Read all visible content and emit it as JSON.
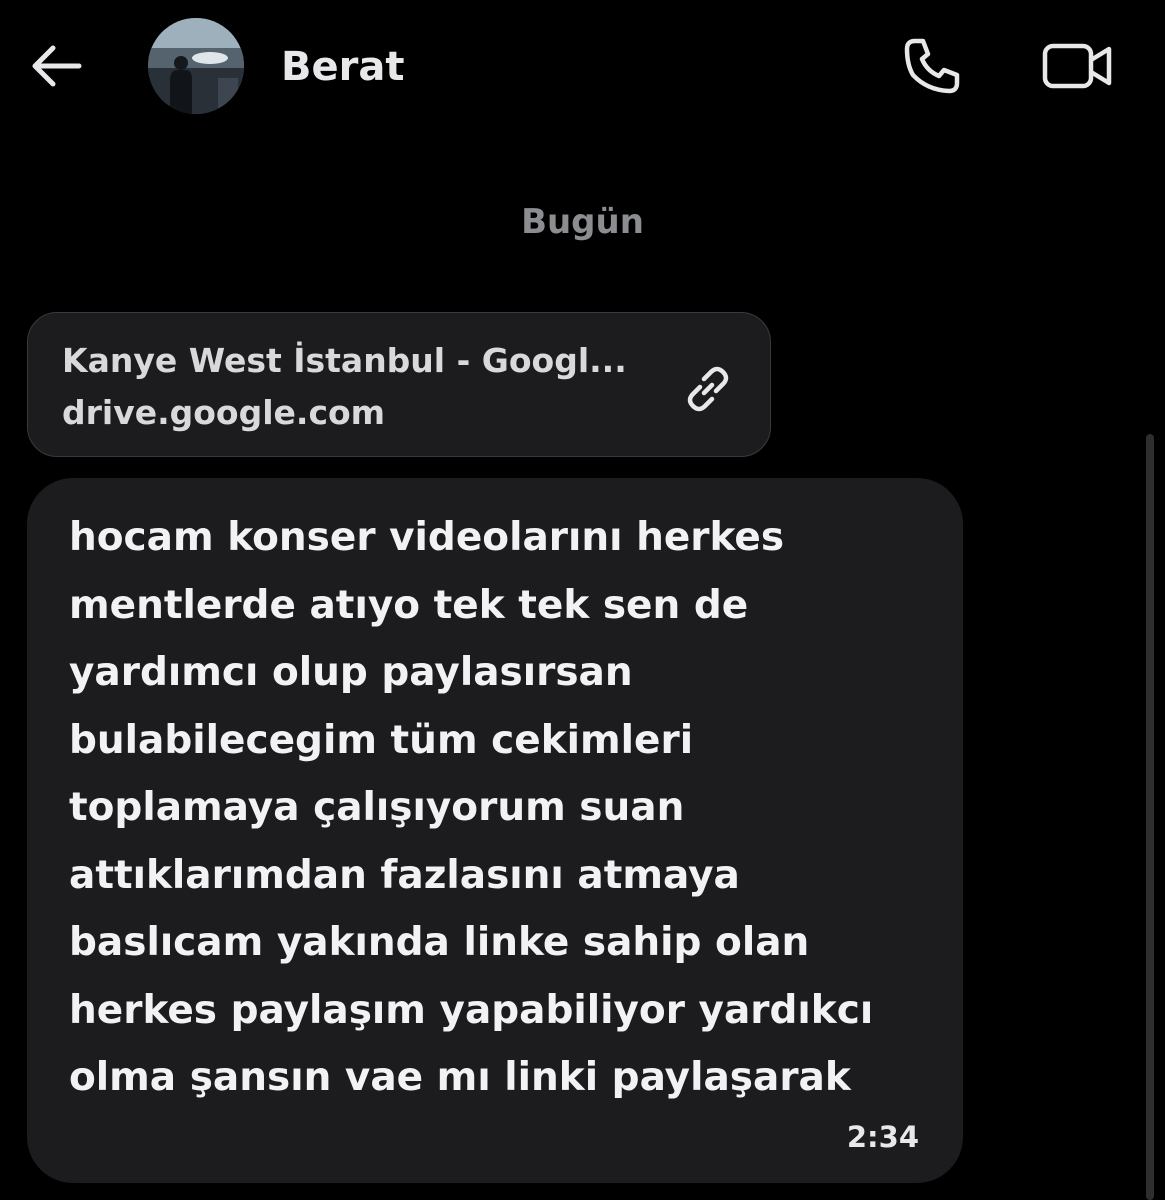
{
  "header": {
    "contact_name": "Berat",
    "back_icon": "arrow-left-icon",
    "call_icon": "phone-icon",
    "video_icon": "video-camera-icon",
    "avatar_alt": "contact-avatar-photo"
  },
  "conversation": {
    "date_label": "Bugün",
    "link_preview": {
      "title": "Kanye West İstanbul - Googl...",
      "domain": "drive.google.com",
      "icon": "link-icon"
    },
    "message": {
      "lines": [
        "hocam konser videolarını herkes",
        "mentlerde atıyo tek tek sen de",
        "yardımcı olup paylasırsan",
        "bulabilecegim tüm cekimleri",
        "toplamaya çalışıyorum suan",
        "attıklarımdan fazlasını atmaya",
        "baslıcam yakında linke sahip olan",
        "herkes paylaşım yapabiliyor yardıkcı",
        "olma şansın vae mı linki paylaşarak"
      ],
      "time": "2:34"
    }
  },
  "colors": {
    "background": "#000000",
    "bubble": "#1c1c1e",
    "text": "#f2f2f4",
    "muted": "#8b8d91"
  }
}
